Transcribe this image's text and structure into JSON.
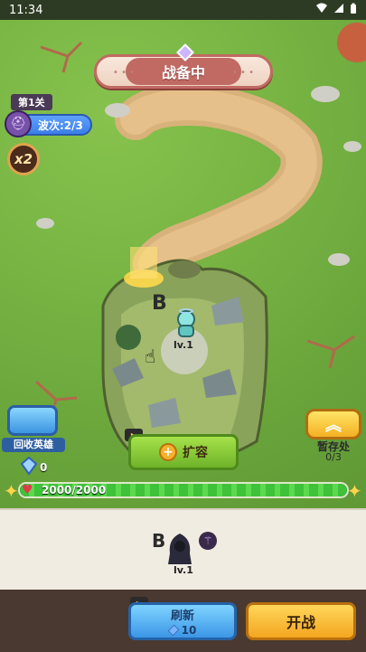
{
  "status_bar": {
    "time": "11:34"
  },
  "header": {
    "title": "战备中"
  },
  "level": {
    "label": "第1关"
  },
  "wave": {
    "text": "波次:2/3"
  },
  "speed": {
    "label": "x2"
  },
  "board_hero": {
    "rank": "B",
    "level": "lv.1"
  },
  "left_controls": {
    "recycle_label": "回收英雄",
    "gem_count": "0"
  },
  "expand": {
    "label": "扩容"
  },
  "storage": {
    "label": "暂存处",
    "count": "0/3"
  },
  "hp": {
    "text": "2000/2000",
    "fraction": 1.0
  },
  "bench_hero": {
    "rank": "B",
    "level": "lv.1"
  },
  "refresh": {
    "label": "刷新",
    "cost": "10"
  },
  "start": {
    "label": "开战"
  },
  "colors": {
    "accent": "#6fb32a",
    "banner": "#c06a63",
    "hp": "#3fc23a"
  }
}
